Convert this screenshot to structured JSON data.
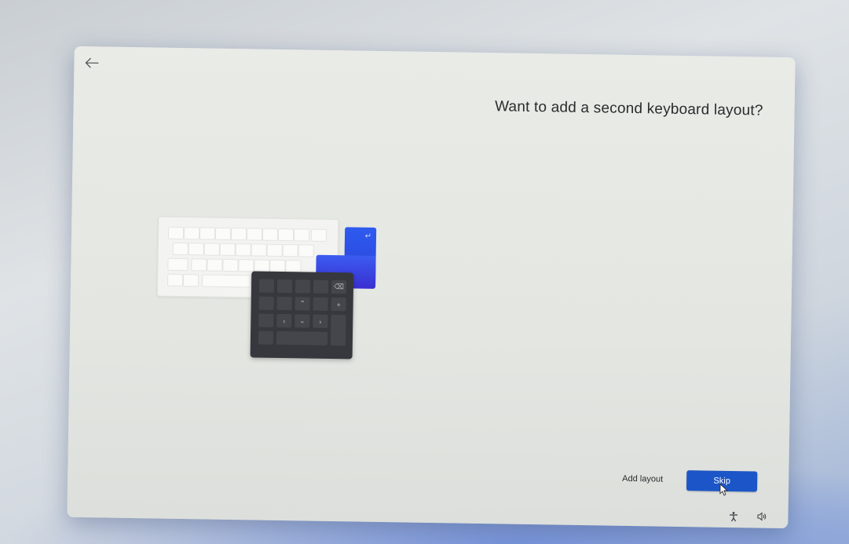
{
  "page": {
    "title": "Want to add a second keyboard layout?"
  },
  "actions": {
    "add_layout_label": "Add layout",
    "skip_label": "Skip"
  },
  "icons": {
    "back": "back-arrow-icon",
    "accessibility": "accessibility-icon",
    "volume": "volume-icon",
    "cursor": "mouse-cursor-icon"
  },
  "colors": {
    "accent": "#1c55c7",
    "illustration_blue": "#2e5bef",
    "illustration_dark": "#37383d"
  }
}
